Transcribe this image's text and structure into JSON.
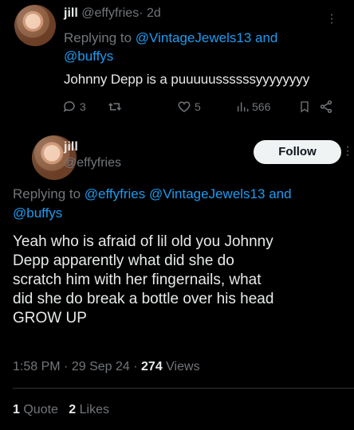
{
  "reply_tweet": {
    "name": "jill",
    "handle": "@effyfries",
    "separator": "·",
    "time": "2d",
    "replying_prefix": "Replying to",
    "replying_to": [
      "@VintageJewels13",
      "and",
      "@buffys"
    ],
    "text": "Johnny Depp is a puuuuussssssyyyyyyyy",
    "actions": {
      "replies": "3",
      "retweets": "",
      "likes": "5",
      "views": "566"
    },
    "icons": [
      "reply-icon",
      "retweet-icon",
      "like-icon",
      "views-icon",
      "bookmark-icon",
      "share-icon",
      "more-icon"
    ]
  },
  "main_tweet": {
    "name": "jill",
    "handle": "@effyfries",
    "follow_label": "Follow",
    "replying_prefix": "Replying to",
    "replying_to_line1": "@effyfries @VintageJewels13 and",
    "replying_to_line2": "@buffys",
    "body_lines": [
      "Yeah who is afraid of lil old you Johnny",
      "Depp apparently what did she do",
      "scratch him with her fingernails, what",
      "did she do break a bottle over his head",
      "GROW UP"
    ],
    "time": "1:58 PM",
    "date": "29 Sep 24",
    "separator": "·",
    "views_count": "274",
    "views_label": "Views",
    "quotes_count": "1",
    "quotes_label": "Quote",
    "likes_count": "2",
    "likes_label": "Likes"
  },
  "colors": {
    "background": "#000000",
    "text": "#e7e9ea",
    "muted": "#71767b",
    "link": "#1d9bf0",
    "follow_bg": "#eff3f4"
  }
}
